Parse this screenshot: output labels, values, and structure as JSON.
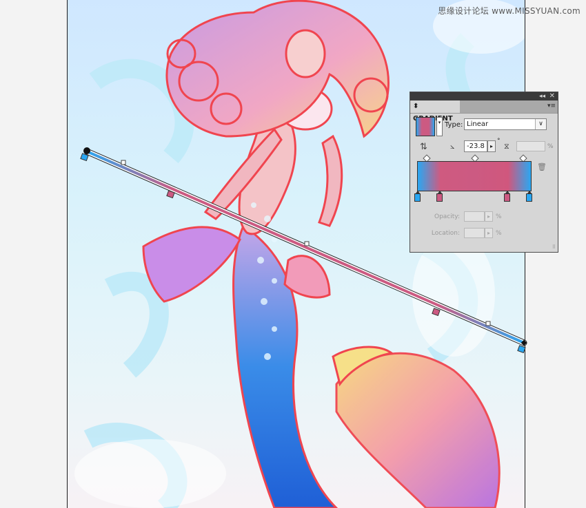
{
  "watermark": "思缘设计论坛 www.MISSYUAN.com",
  "colors": {
    "gradient_blue": "#2aa7f2",
    "gradient_pink": "#cc5a82",
    "path_outline": "#f0454f"
  },
  "panel": {
    "title": "GRADIENT",
    "collapse_glyph": "◂◂",
    "close_glyph": "✕",
    "menu_glyph": "▾≡",
    "type_label": "Type:",
    "type_value": "Linear",
    "select_arrow": "∨",
    "angle_value": "-23.8",
    "stepper_glyph": "▸",
    "degree_symbol": "°",
    "percent": "%",
    "opacity_label": "Opacity:",
    "location_label": "Location:",
    "stops": [
      {
        "color": "#2aa7f2",
        "position": 0
      },
      {
        "color": "#cc5a82",
        "position": 0.2
      },
      {
        "color": "#cc5a82",
        "position": 0.8
      },
      {
        "color": "#2aa7f2",
        "position": 1
      }
    ],
    "midpoints": [
      0.08,
      0.5,
      0.92
    ]
  },
  "icons": {
    "swatch_arrow": "▾",
    "reverse": "⇅",
    "angle": "⦣",
    "aspect": "⧖",
    "trash": "🗑",
    "grip": "⠿"
  }
}
